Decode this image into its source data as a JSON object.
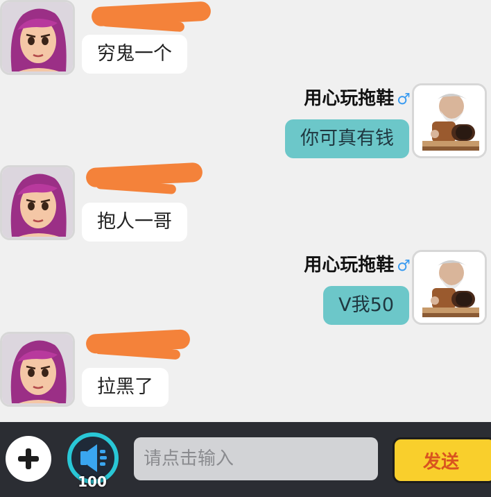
{
  "messages": [
    {
      "direction": "incoming",
      "sender": "",
      "text": "穷鬼一个"
    },
    {
      "direction": "outgoing",
      "sender": "用心玩拖鞋",
      "gender_symbol": "♂",
      "text": "你可真有钱"
    },
    {
      "direction": "incoming",
      "sender": "",
      "text": "抱人一哥"
    },
    {
      "direction": "outgoing",
      "sender": "用心玩拖鞋",
      "gender_symbol": "♂",
      "text": "V我50"
    },
    {
      "direction": "incoming",
      "sender": "",
      "text": "拉黑了"
    }
  ],
  "input_bar": {
    "add_icon": "plus-icon",
    "voice_icon": "speaker-icon",
    "voice_count": "100",
    "input_placeholder": "请点击输入",
    "send_label": "发送"
  },
  "colors": {
    "background": "#f0f0f0",
    "incoming_bubble": "#ffffff",
    "outgoing_bubble": "#6cc7c9",
    "gender_male": "#3a9bf0",
    "redaction": "#f4823a",
    "bar_background": "#2b2d33",
    "send_button": "#f9cf2c",
    "send_text": "#d9541f",
    "voice_ring": "#29c7d6"
  }
}
